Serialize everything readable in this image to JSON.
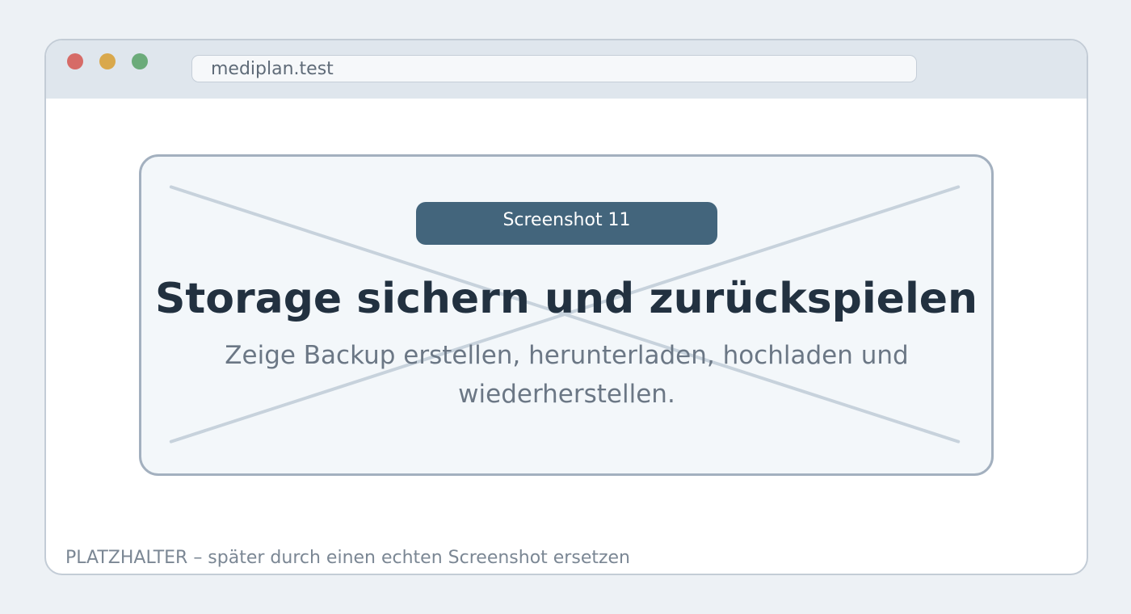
{
  "browser": {
    "address": "mediplan.test",
    "controls": {
      "close_color": "#d66b67",
      "minimize_color": "#d9a84c",
      "zoom_color": "#6bab7a"
    }
  },
  "placeholder": {
    "badge": "Screenshot 11",
    "title": "Storage sichern und zurückspielen",
    "description": "Zeige Backup erstellen, herunterladen, hochladen und wiederherstellen.",
    "cross_icon": "x-cross-icon"
  },
  "footer": {
    "note": "PLATZHALTER – später durch einen echten Screenshot ersetzen"
  },
  "colors": {
    "page_background": "#edf1f5",
    "badge_background": "#43657c",
    "title_color": "#223140",
    "card_border": "#a3b0bf"
  }
}
